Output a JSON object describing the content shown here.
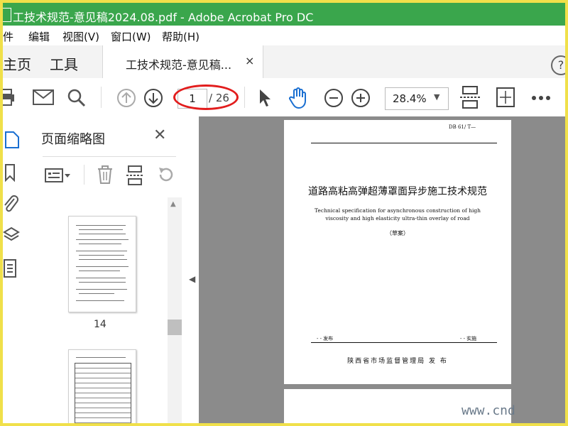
{
  "window": {
    "title": "工技术规范-意见稿2024.08.pdf - Adobe Acrobat Pro DC"
  },
  "menu": [
    "件",
    "编辑",
    "视图(V)",
    "窗口(W)",
    "帮助(H)"
  ],
  "tabs": {
    "home": "主页",
    "tools": "工具",
    "document": "工技术规范-意见稿...",
    "close": "×"
  },
  "toolbar": {
    "current_page": "1",
    "page_count": "/ 26",
    "zoom": "28.4%"
  },
  "panel": {
    "title": "页面缩略图",
    "thumbnail_label": "14"
  },
  "document": {
    "std_code": "DB 61/  T—",
    "title_cn": "道路高粘高弹超薄罩面异步施工技术规范",
    "title_en": "Technical specification for asynchronous construction of high viscosity and high elasticity ultra-thin overlay of road",
    "draft": "（草案）",
    "release": "-  -  发布",
    "implement": "-  -  实施",
    "issuer": "陕西省市场监督管理局    发 布"
  },
  "watermark": "www.cnd",
  "colors": {
    "title_bar": "#3aa64c",
    "accent_blue": "#1a6fd1",
    "annotation_red": "#e21d1d",
    "border_yellow": "#f0e04a"
  }
}
